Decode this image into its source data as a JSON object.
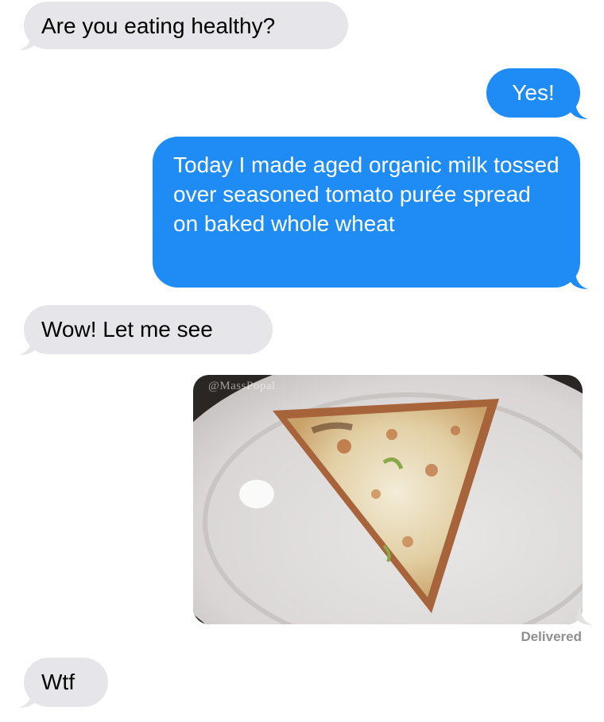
{
  "messages": [
    {
      "from": "them",
      "text": "Are you eating healthy?"
    },
    {
      "from": "me",
      "text": "Yes!"
    },
    {
      "from": "me",
      "text": "Today I made aged organic milk tossed over seasoned tomato purée spread on baked whole wheat"
    },
    {
      "from": "them",
      "text": "Wow! Let me see"
    },
    {
      "from": "me",
      "type": "image",
      "image_desc": "pizza-slice-on-plate",
      "watermark": "@MassPopal"
    },
    {
      "from": "them",
      "text": "Wtf"
    }
  ],
  "status": "Delivered",
  "colors": {
    "sent_bubble": "#1f8cf6",
    "received_bubble": "#e5e5ea",
    "status_text": "#8e8e93"
  }
}
